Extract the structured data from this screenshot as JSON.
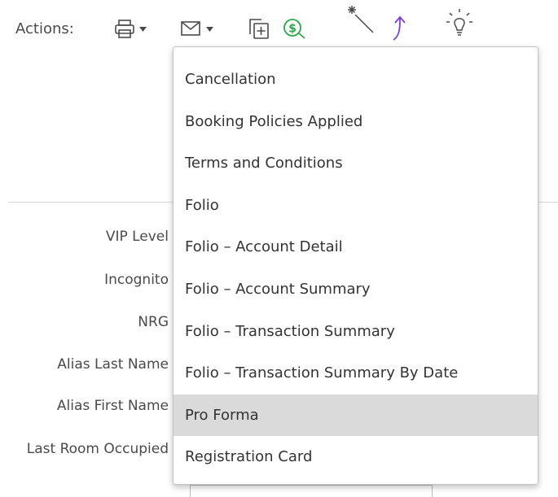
{
  "toolbar": {
    "actions_label": "Actions:",
    "icons": [
      "printer-dropdown-icon",
      "email-dropdown-icon",
      "add-copy-icon",
      "payment-icon",
      "magic-wand-icon",
      "upload-arrow-icon",
      "lightbulb-icon"
    ],
    "colors": {
      "default": "#4a4a4a",
      "payment": "#2aa84a",
      "upload": "#7a3cd6"
    }
  },
  "form": {
    "labels": [
      "VIP Level",
      "Incognito",
      "NRG",
      "Alias Last Name",
      "Alias First Name",
      "Last Room Occupied"
    ]
  },
  "menu": {
    "items": [
      "Cancellation",
      "Booking Policies Applied",
      "Terms and Conditions",
      "Folio",
      "Folio – Account Detail",
      "Folio – Account Summary",
      "Folio – Transaction Summary",
      "Folio – Transaction Summary By Date",
      "Pro Forma",
      "Registration Card"
    ],
    "selected_item": "Pro Forma",
    "selected_bg": "#dadada"
  }
}
